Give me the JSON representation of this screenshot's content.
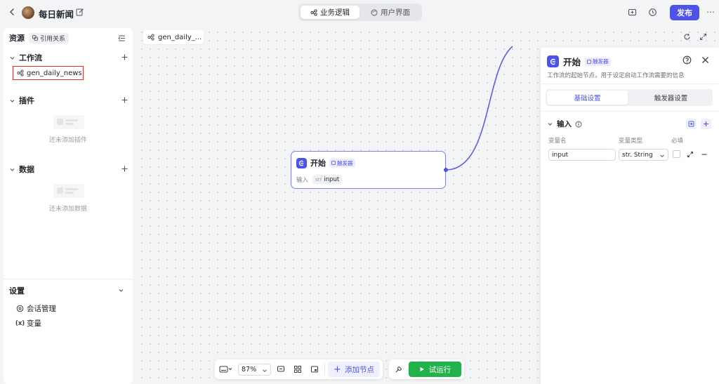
{
  "header": {
    "app_title": "每日新闻",
    "mode_tabs": [
      {
        "label": "业务逻辑",
        "active": true
      },
      {
        "label": "用户界面",
        "active": false
      }
    ],
    "publish_label": "发布",
    "icons": [
      "chevron-left-icon",
      "edit-icon",
      "workflow-icon",
      "palette-icon",
      "monitor-icon",
      "history-icon",
      "more-icon"
    ]
  },
  "sidebar": {
    "resources_title": "资源",
    "references_label": "引用关系",
    "sections": [
      {
        "title": "工作流",
        "items": [
          "gen_daily_news"
        ],
        "empty_text": ""
      },
      {
        "title": "插件",
        "items": [],
        "empty_text": "还未添加插件"
      },
      {
        "title": "数据",
        "items": [],
        "empty_text": "还未添加数据"
      }
    ],
    "settings": {
      "title": "设置",
      "items": [
        {
          "label": "会话管理",
          "icon": "chat-icon"
        },
        {
          "label": "变量",
          "icon": "variable-icon",
          "glyph": "(x)"
        }
      ]
    }
  },
  "canvas": {
    "tab_label": "gen_daily_...",
    "start_node": {
      "title": "开始",
      "badge": "触发器",
      "io_label": "输入",
      "io_type": "str",
      "io_value": "input"
    }
  },
  "panel": {
    "title": "开始",
    "badge": "触发器",
    "description": "工作流的起始节点，用于设定启动工作流需要的信息",
    "tabs": [
      {
        "label": "基础设置",
        "active": true
      },
      {
        "label": "触发器设置",
        "active": false
      }
    ],
    "input_section": {
      "title": "输入",
      "columns": [
        "变量名",
        "变量类型",
        "必填"
      ],
      "rows": [
        {
          "name": "input",
          "type": "str. String",
          "required": false
        }
      ]
    }
  },
  "toolbar": {
    "zoom": "87%",
    "add_node_label": "添加节点",
    "run_label": "试运行"
  },
  "colors": {
    "accent": "#4d53e8",
    "run_green": "#22b24c",
    "highlight_border": "#e0312b"
  }
}
